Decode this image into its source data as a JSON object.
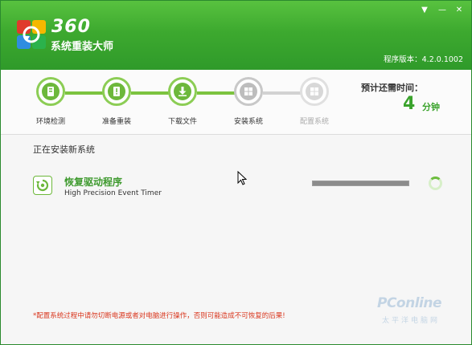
{
  "app": {
    "brand_number": "360",
    "brand_name": "系统重装大师",
    "version": "程序版本：4.2.0.1002"
  },
  "window_controls": {
    "menu_icon": "▼",
    "minimize_icon": "—",
    "close_icon": "✕"
  },
  "steps": [
    {
      "label": "环境检测",
      "state": "done",
      "icon": "computer-check-icon"
    },
    {
      "label": "准备重装",
      "state": "done",
      "icon": "document-warning-icon"
    },
    {
      "label": "下载文件",
      "state": "done",
      "icon": "download-icon"
    },
    {
      "label": "安装系统",
      "state": "current",
      "icon": "windows-icon"
    },
    {
      "label": "配置系统",
      "state": "pending",
      "icon": "windows-config-icon"
    }
  ],
  "estimate": {
    "title": "预计还需时间：",
    "value": "4",
    "unit": "分钟"
  },
  "main": {
    "section_title": "正在安装新系统",
    "task": {
      "name": "恢复驱动程序",
      "subtitle": "High Precision Event Timer",
      "progress": 1.0,
      "icon": "restore-driver-icon"
    },
    "warning": "*配置系统过程中请勿切断电源或者对电脑进行操作，否则可能造成不可恢复的后果!"
  },
  "watermark": {
    "text": "PConline",
    "sub": "太平洋电脑网"
  },
  "colors": {
    "accent_green": "#3da92f",
    "warning_red": "#d9361d"
  }
}
